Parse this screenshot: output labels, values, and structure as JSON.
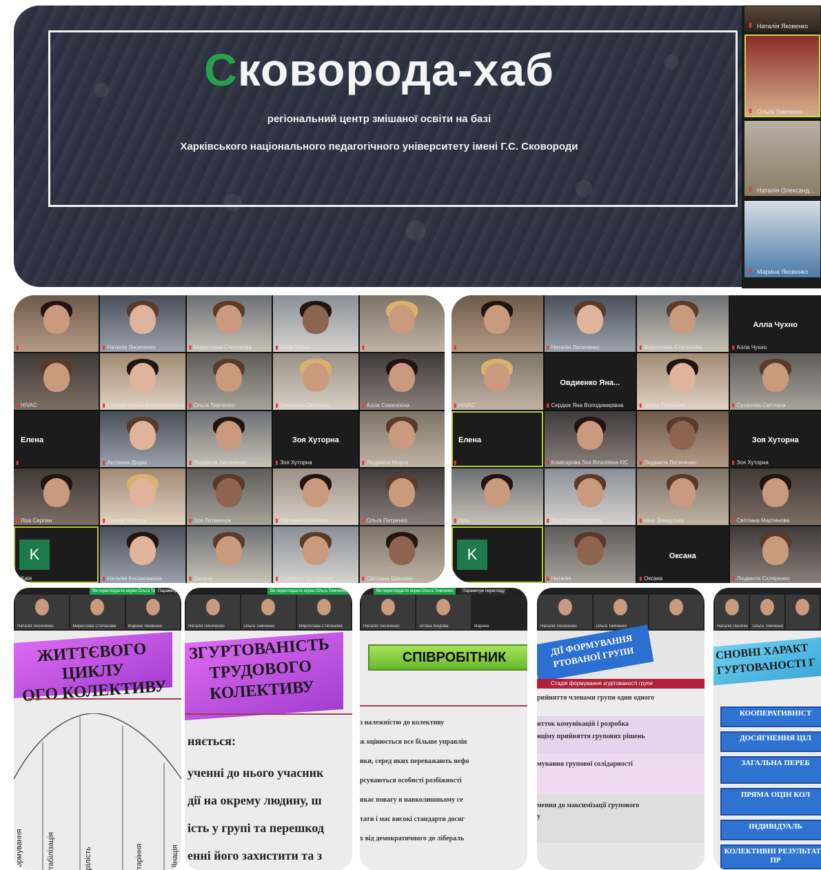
{
  "banner": {
    "title_accent": "С",
    "title_rest": "коворода-хаб",
    "subtitle_1": "регіональний центр змішаної освіти на базі",
    "subtitle_2": "Харківського національного педагогічного університету імені Г.С. Сковороди"
  },
  "side_strip": {
    "participants": [
      "Наталія Яковенко",
      "Ольга Тимченко",
      "Наталія Олександ...",
      "Марина Яковенко"
    ]
  },
  "grid_left": {
    "tiles": [
      {
        "caption": ""
      },
      {
        "caption": "Наталія Лисиченко"
      },
      {
        "caption": "Мирослава Степанова"
      },
      {
        "caption": "Алла Чухно"
      },
      {
        "caption": ""
      },
      {
        "caption": "HIVAC"
      },
      {
        "caption": "Сердюк Ольга Володимирівна"
      },
      {
        "caption": "Ольга Тимченко"
      },
      {
        "caption": "Суханова Світлана"
      },
      {
        "caption": "Алла Семеніхіна"
      },
      {
        "name": "Елена",
        "caption": ""
      },
      {
        "caption": "Антоніна Дидак"
      },
      {
        "caption": "Людмила Лисиченко"
      },
      {
        "name": "Зоя Хуторна",
        "caption": "Зоя Хуторна"
      },
      {
        "caption": "Людмила Мороз"
      },
      {
        "caption": "Ліза Серпан"
      },
      {
        "caption": "Тетяна Жидова"
      },
      {
        "caption": "Зоя Литвинчук"
      },
      {
        "caption": "Світлана Богачова"
      },
      {
        "caption": "Ольга Петренко"
      },
      {
        "avatar": "K",
        "caption": "Kate"
      },
      {
        "caption": "Наталія Косоножкина"
      },
      {
        "caption": "Оксана"
      },
      {
        "caption": "Людмила Скляренко"
      },
      {
        "caption": "Світлана Шишова"
      }
    ]
  },
  "grid_right": {
    "tiles": [
      {
        "caption": ""
      },
      {
        "caption": "Наталія Лисиченко"
      },
      {
        "caption": "Мирослава Степанова"
      },
      {
        "name": "Алла Чухно",
        "caption": "Алла Чухно"
      },
      {
        "caption": "HIVAC"
      },
      {
        "name": "Овдиенко Яна...",
        "caption": "Сердюк Яна Володимирівна"
      },
      {
        "caption": "Ольга Тимченко"
      },
      {
        "caption": "Суханова Світлана"
      },
      {
        "name": "Елена",
        "caption": ""
      },
      {
        "caption": "Комісарова Зоя Віталіївна КІС"
      },
      {
        "caption": "Людмила Лисиченко"
      },
      {
        "name": "Зоя Хуторна",
        "caption": "Зоя Хуторна"
      },
      {
        "caption": "Ліза"
      },
      {
        "caption": "Ліза Олександрівна"
      },
      {
        "caption": "Ніна Завадська"
      },
      {
        "caption": "Світлана Мартинова"
      },
      {
        "avatar": "K",
        "caption": ""
      },
      {
        "caption": "Наталія"
      },
      {
        "name": "Оксана",
        "caption": "Оксана"
      },
      {
        "caption": "Людмила Скляренко"
      }
    ]
  },
  "slides": [
    {
      "notice": "Ви переглядаєте екран Ольга Тимченко",
      "view": "Параметри",
      "mini": [
        "Наталія Лисиченко",
        "Мирослава Степанова",
        "Марина Яковенко"
      ],
      "title_lines": [
        "ЖИТТЄВОГО ЦИКЛУ",
        "ОГО КОЛЕКТИВУ"
      ],
      "stages": [
        "формування",
        "стабілізація",
        "зрілість",
        "старіння",
        "рійнація"
      ]
    },
    {
      "notice": "Ви переглядаєте екран Ольга Тимченко",
      "mini": [
        "Наталія Лисиченко",
        "Ольга Тимченко",
        "Мирослава Степанова"
      ],
      "title_lines": [
        "ЗГУРТОВАНІСТЬ",
        "ТРУДОВОГО",
        "КОЛЕКТИВУ"
      ],
      "lines": [
        "няється:",
        "ученні до нього учасник",
        "дії на окрему людину, ш",
        "ість у групі та перешкод",
        "енні його захистити та з"
      ]
    },
    {
      "notice": "Ви переглядаєте екран Ольга Тимченко",
      "view": "Параметри перегляду",
      "mini": [
        "Наталія Лисиченко",
        "Тетяна Жидова",
        "Марина"
      ],
      "box_title": "СПІВРОБІТНИК",
      "lines": [
        "з належністю до колективу",
        "ж оцінюється все більше управлін",
        "ики, серед яких переважають нефо",
        "рсуваються особисті розбіжності",
        "икає повагу в навколишньому се",
        "тати і має високі стандарти досяг",
        "х від демократичного до лібераль"
      ]
    },
    {
      "mini": [
        "Наталія Лисиченко",
        "Ольга Тимченко",
        ""
      ],
      "tag_lines": [
        "ДІЇ ФОРМУВАННЯ",
        "РТОВАНОЇ ГРУПИ"
      ],
      "header": "Стадія формування згуртованості групи",
      "lines": [
        "рийняття членами групи один одного",
        "итток комунікацій і розробка",
        "нціму прийняття групових рішень",
        "мування групової солідарності",
        "мення до максимізації групового",
        "у"
      ]
    },
    {
      "mini": [
        "Наталія Лисиченко",
        "Ольга Тимченко",
        ""
      ],
      "title_lines": [
        "СНОВНІ ХАРАКТ",
        "ГУРТОВАНОСТІ Г"
      ],
      "buttons": [
        "КООПЕРАТИВНІСТ",
        "ДОСЯГНЕННЯ ЦІЛ",
        "ЗАГАЛЬНА ПЕРЕБ",
        "ПРЯМА ОЦІН КОЛ",
        "ІНДИВІДУАЛЬ",
        "КОЛЕКТИВНІ РЕЗУЛЬТАТИ ПР"
      ]
    }
  ],
  "colors": {
    "accent_green": "#27a24b",
    "zoom_bg": "#1f1f1f",
    "purple": "#b64ee0",
    "blue": "#2f73d2"
  }
}
